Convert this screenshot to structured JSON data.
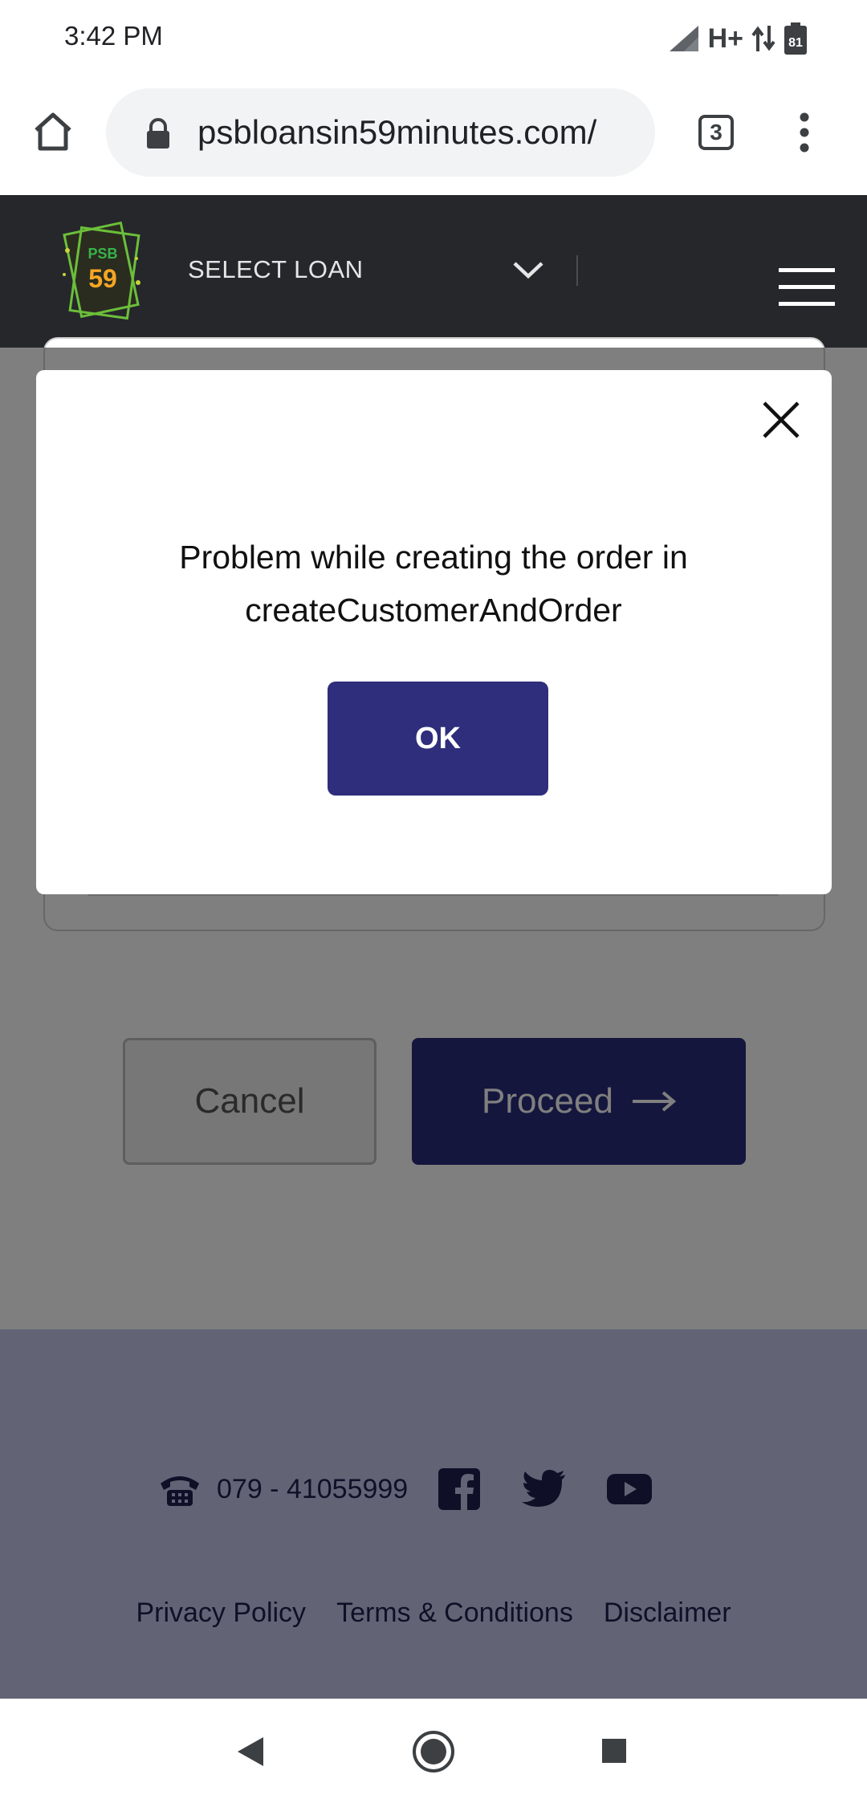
{
  "status_bar": {
    "time": "3:42 PM",
    "network": "H+",
    "battery": "81"
  },
  "browser": {
    "url": "psbloansin59minutes.com/",
    "tab_count": "3"
  },
  "header": {
    "logo_line1": "PSB",
    "logo_line2": "59",
    "select_label": "SELECT LOAN"
  },
  "form": {
    "cancel_label": "Cancel",
    "proceed_label": "Proceed"
  },
  "footer": {
    "phone": "079 - 41055999",
    "links": [
      "Privacy Policy",
      "Terms & Conditions",
      "Disclaimer"
    ]
  },
  "modal": {
    "message": "Problem while creating the order in createCustomerAndOrder",
    "ok_label": "OK"
  },
  "colors": {
    "brand_dark": "#25272b",
    "button_navy": "#2e2e7c",
    "footer_bg": "#c4c8ec"
  }
}
